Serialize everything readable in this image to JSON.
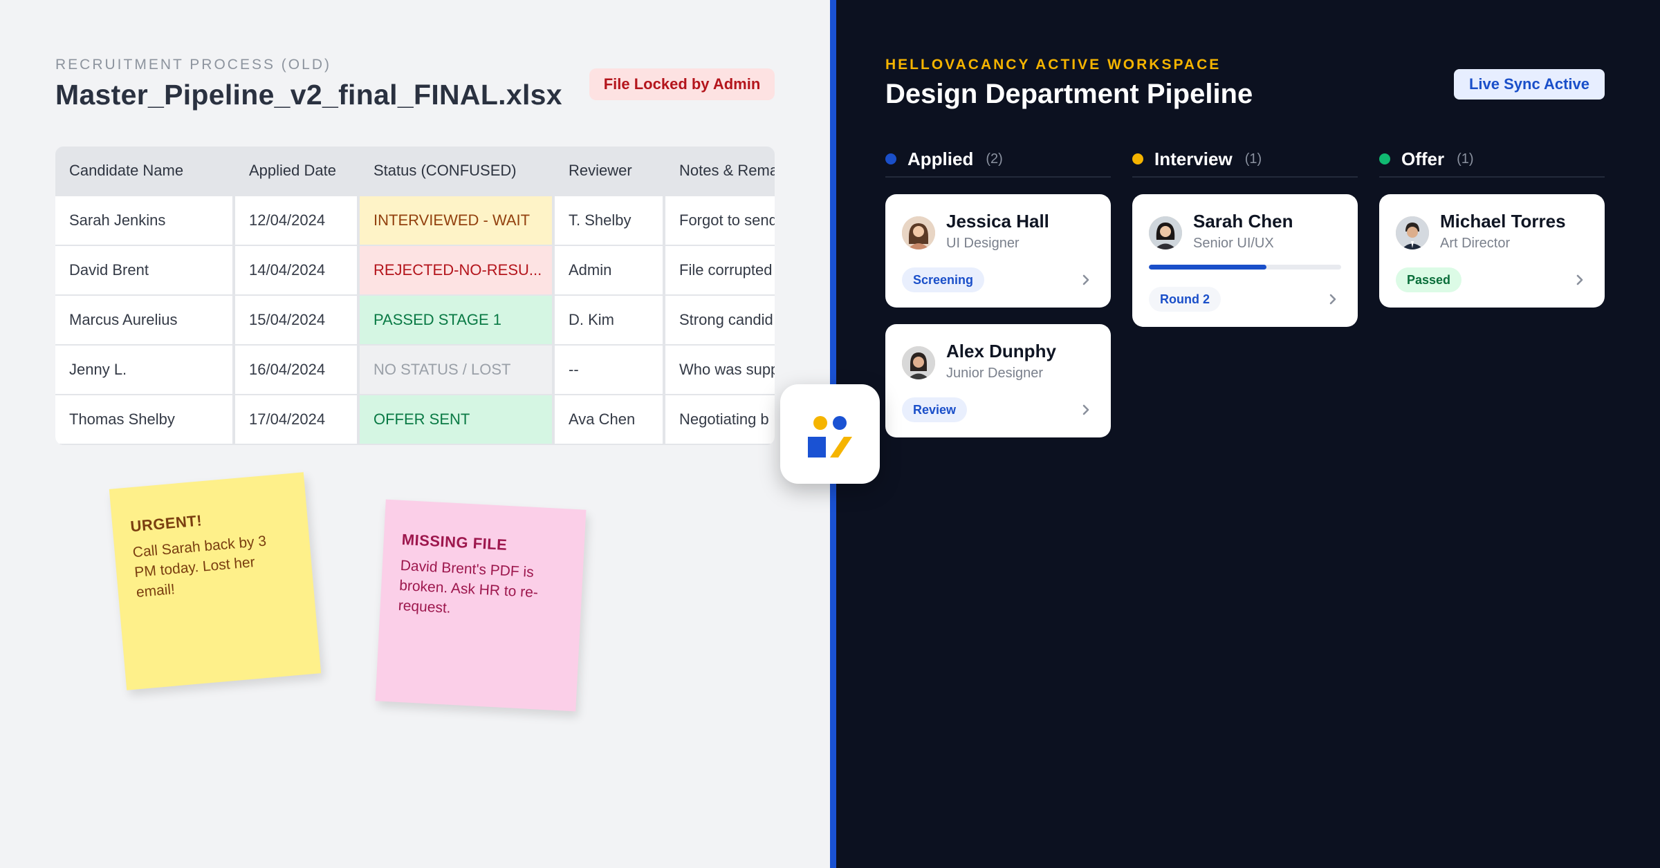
{
  "left": {
    "eyebrow": "RECRUITMENT PROCESS (OLD)",
    "file_title": "Master_Pipeline_v2_final_FINAL.xlsx",
    "locked_badge": "File Locked by Admin",
    "table": {
      "headers": [
        "Candidate Name",
        "Applied Date",
        "Status (CONFUSED)",
        "Reviewer",
        "Notes & Rema"
      ],
      "rows": [
        {
          "name": "Sarah Jenkins",
          "date": "12/04/2024",
          "status": "INTERVIEWED - WAIT",
          "reviewer": "T. Shelby",
          "notes": "Forgot to send"
        },
        {
          "name": "David Brent",
          "date": "14/04/2024",
          "status": "REJECTED-NO-RESU...",
          "reviewer": "Admin",
          "notes": "File corrupted"
        },
        {
          "name": "Marcus Aurelius",
          "date": "15/04/2024",
          "status": "PASSED STAGE 1",
          "reviewer": "D. Kim",
          "notes": "Strong candid"
        },
        {
          "name": "Jenny L.",
          "date": "16/04/2024",
          "status": "NO STATUS / LOST",
          "reviewer": "--",
          "notes": "Who was supp"
        },
        {
          "name": "Thomas Shelby",
          "date": "17/04/2024",
          "status": "OFFER SENT",
          "reviewer": "Ava Chen",
          "notes": "Negotiating b"
        }
      ]
    },
    "stickies": [
      {
        "heading": "URGENT!",
        "body": "Call Sarah back by 3 PM today. Lost her email!"
      },
      {
        "heading": "MISSING FILE",
        "body": "David Brent's PDF is broken. Ask HR to re-request."
      }
    ]
  },
  "right": {
    "eyebrow": "HELLOVACANCY ACTIVE WORKSPACE",
    "title": "Design Department Pipeline",
    "sync_badge": "Live Sync Active",
    "columns": [
      {
        "name": "Applied",
        "count": "(2)",
        "dot_color": "#1a4fc9"
      },
      {
        "name": "Interview",
        "count": "(1)",
        "dot_color": "#f5b400"
      },
      {
        "name": "Offer",
        "count": "(1)",
        "dot_color": "#10b971"
      }
    ],
    "cards": {
      "jessica": {
        "name": "Jessica Hall",
        "role": "UI Designer",
        "tag": "Screening"
      },
      "alex": {
        "name": "Alex Dunphy",
        "role": "Junior Designer",
        "tag": "Review"
      },
      "sarah": {
        "name": "Sarah Chen",
        "role": "Senior UI/UX",
        "tag": "Round 2",
        "progress": 0.61
      },
      "michael": {
        "name": "Michael Torres",
        "role": "Art Director",
        "tag": "Passed"
      }
    }
  },
  "colors": {
    "brand_blue": "#1a52d3",
    "brand_yellow": "#f5b400",
    "dark_bg": "#0c1120"
  }
}
